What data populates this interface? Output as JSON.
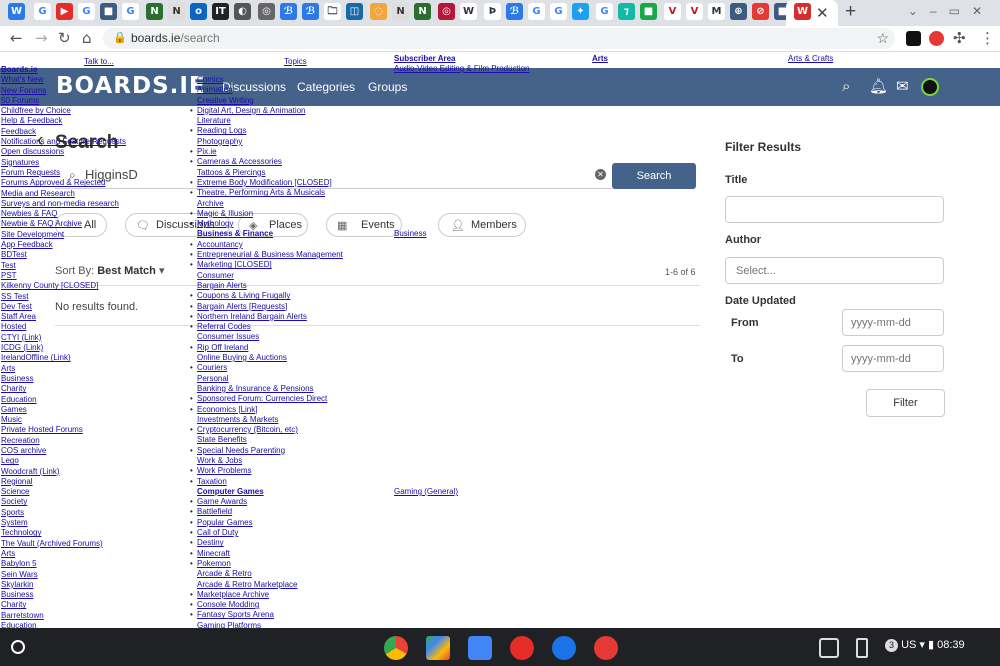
{
  "browser": {
    "url_host": "boards.ie",
    "url_path": "/search"
  },
  "site": {
    "logo": "BOARDS.IE",
    "nav": [
      "Discussions",
      "Categories",
      "Groups"
    ]
  },
  "search": {
    "title": "Search",
    "query": "HigginsD",
    "button": "Search",
    "filters": [
      "All",
      "Discussions",
      "Places",
      "Events",
      "Members"
    ],
    "sort_label": "Sort By:",
    "sort_value": "Best Match",
    "count": "1-6 of 6",
    "no_results": "No results found."
  },
  "filter_panel": {
    "title": "Filter Results",
    "title_label": "Title",
    "author_label": "Author",
    "author_placeholder": "Select...",
    "date_label": "Date Updated",
    "from_label": "From",
    "to_label": "To",
    "date_placeholder": "yyyy-mm-dd",
    "button": "Filter"
  },
  "overlay": {
    "top_links": [
      "Talk to...",
      "Topics",
      "Subscriber Area",
      "Audio-Video Editing & Film Production",
      "Arts",
      "Arts & Crafts"
    ],
    "left_col": [
      "Boards.ie",
      "What's New",
      "New Forums",
      "50 Forums",
      "Childfree by Choice",
      "Help & Feedback",
      "Feedback",
      "Notifications and Feature Requests",
      "Open discussions",
      "Signatures",
      "Forum Requests",
      "Forums Approved & Rejected",
      "Media and Research",
      "Surveys and non-media research",
      "Newbies & FAQ",
      "Newbie & FAQ Archive",
      "Site Development",
      "App Feedback",
      "BDTest",
      "Test",
      "PST",
      "Kilkenny County [CLOSED]",
      "SS Test",
      "Dev Test",
      "Staff Area",
      "Hosted",
      "CTYI (Link)",
      "ICDG (Link)",
      "IrelandOffline (Link)",
      "Arts",
      "Business",
      "Charity",
      "Education",
      "Games",
      "Music",
      "Private Hosted Forums",
      "Recreation",
      "COS archive",
      "Lego",
      "Woodcraft (Link)",
      "Regional",
      "Science",
      "Society",
      "Sports",
      "System",
      "Technology",
      "The Vault (Archived Forums)",
      "Arts",
      "Babylon 5",
      "Sein Wars",
      "Skylarkin",
      "Business",
      "Charity",
      "Barretstown",
      "Education"
    ],
    "mid_col": [
      {
        "t": "Comics",
        "b": false
      },
      {
        "t": "Animation",
        "b": false
      },
      {
        "t": "Creative Writing",
        "b": false
      },
      {
        "t": "Digital Art, Design & Animation",
        "b": true
      },
      {
        "t": "Literature",
        "b": false
      },
      {
        "t": "Reading Logs",
        "b": true
      },
      {
        "t": "Photography",
        "b": false
      },
      {
        "t": "Pix.ie",
        "b": true
      },
      {
        "t": "Cameras & Accessories",
        "b": true
      },
      {
        "t": "Tattoos & Piercings",
        "b": false
      },
      {
        "t": "Extreme Body Modification [CLOSED]",
        "b": true
      },
      {
        "t": "Theatre, Performing Arts & Musicals",
        "b": true
      },
      {
        "t": "Archive",
        "b": false
      },
      {
        "t": "Magic & Illusion",
        "b": true
      },
      {
        "t": "Mythology",
        "b": true
      },
      {
        "t": "Business & Finance",
        "b": false,
        "bold": true
      },
      {
        "t": "Accountancy",
        "b": true
      },
      {
        "t": "Entrepreneurial & Business Management",
        "b": true
      },
      {
        "t": "Marketing [CLOSED]",
        "b": true
      },
      {
        "t": "Consumer",
        "b": false
      },
      {
        "t": "Bargain Alerts",
        "b": false
      },
      {
        "t": "Coupons & Living Frugally",
        "b": true
      },
      {
        "t": "Bargain Alerts [Requests]",
        "b": true
      },
      {
        "t": "Northern Ireland Bargain Alerts",
        "b": true
      },
      {
        "t": "Referral Codes",
        "b": true
      },
      {
        "t": "Consumer Issues",
        "b": false
      },
      {
        "t": "Rip Off Ireland",
        "b": true
      },
      {
        "t": "Online Buying & Auctions",
        "b": false
      },
      {
        "t": "Couriers",
        "b": true
      },
      {
        "t": "Personal",
        "b": false
      },
      {
        "t": "Banking & Insurance & Pensions",
        "b": false
      },
      {
        "t": "Sponsored Forum: Currencies Direct",
        "b": true
      },
      {
        "t": "Economics [Link]",
        "b": true
      },
      {
        "t": "Investments & Markets",
        "b": false
      },
      {
        "t": "Cryptocurrency (Bitcoin, etc)",
        "b": true
      },
      {
        "t": "State Benefits",
        "b": false
      },
      {
        "t": "Special Needs Parenting",
        "b": true
      },
      {
        "t": "Work & Jobs",
        "b": false
      },
      {
        "t": "Work Problems",
        "b": true
      },
      {
        "t": "Taxation",
        "b": true
      },
      {
        "t": "Computer Games",
        "b": false,
        "bold": true
      },
      {
        "t": "Game Awards",
        "b": true
      },
      {
        "t": "Battlefield",
        "b": true
      },
      {
        "t": "Popular Games",
        "b": true
      },
      {
        "t": "Call of Duty",
        "b": true
      },
      {
        "t": "Destiny",
        "b": true
      },
      {
        "t": "Minecraft",
        "b": true
      },
      {
        "t": "Pokemon",
        "b": true
      },
      {
        "t": "Arcade & Retro",
        "b": false
      },
      {
        "t": "Arcade & Retro Marketplace",
        "b": false
      },
      {
        "t": "Marketplace Archive",
        "b": true
      },
      {
        "t": "Console Modding",
        "b": true
      },
      {
        "t": "Fantasy Sports Arena",
        "b": true
      },
      {
        "t": "Gaming Platforms",
        "b": false
      }
    ],
    "right_links": [
      "Business",
      "Gaming (General)"
    ]
  },
  "taskbar": {
    "status": "US",
    "badge": "3",
    "time": "08:39"
  }
}
